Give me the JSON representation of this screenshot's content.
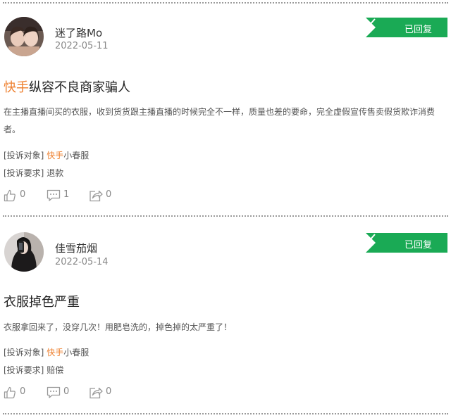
{
  "reviews": [
    {
      "username": "迷了路Mo",
      "date": "2022-05-11",
      "status": "已回复",
      "title_brand": "快手",
      "title_rest": "纵容不良商家骗人",
      "content": "在主播直播间买的衣服，收到货货跟主播直播的时候完全不一样，质量也差的要命，完全虚假宣传售卖假货欺诈消费者。",
      "target_label": "[投诉对象]",
      "target_brand": "快手",
      "target_rest": "小春服",
      "request_label": "[投诉要求]",
      "request_value": "退款",
      "likes": "0",
      "comments": "1",
      "shares": "0"
    },
    {
      "username": "佳雪茄烟",
      "date": "2022-05-14",
      "status": "已回复",
      "title_brand": "",
      "title_rest": "衣服掉色严重",
      "content": "衣服拿回来了，没穿几次！用肥皂洗的，掉色掉的太严重了！",
      "target_label": "[投诉对象]",
      "target_brand": "快手",
      "target_rest": "小春服",
      "request_label": "[投诉要求]",
      "request_value": "赔偿",
      "likes": "0",
      "comments": "0",
      "shares": "0"
    }
  ],
  "colors": {
    "status_green": "#1aaa55",
    "brand_orange": "#ee7f2d"
  },
  "icons": {
    "like": "thumbs-up-icon",
    "comment": "comment-icon",
    "share": "share-icon",
    "status": "check-icon"
  }
}
